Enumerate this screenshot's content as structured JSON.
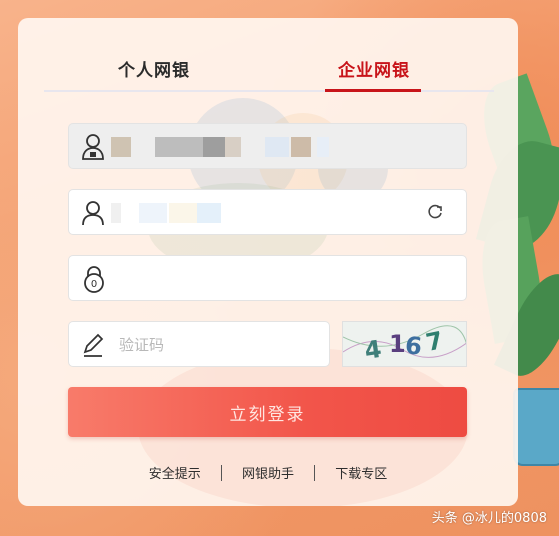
{
  "tabs": {
    "personal": "个人网银",
    "enterprise": "企业网银",
    "active": "enterprise"
  },
  "form": {
    "username_field": {
      "icon": "user-lock-icon",
      "value_masked": true
    },
    "operator_field": {
      "icon": "user-icon",
      "value_masked": true,
      "refresh_icon": "refresh-icon"
    },
    "password_field": {
      "icon": "padlock-icon",
      "value": ""
    },
    "captcha_field": {
      "icon": "pencil-icon",
      "placeholder": "验证码",
      "value": ""
    },
    "captcha_image_text": "4167"
  },
  "login_button": "立刻登录",
  "footer_links": [
    "安全提示",
    "网银助手",
    "下载专区"
  ],
  "watermark": "头条 @冰儿的0808",
  "colors": {
    "accent": "#c8141a",
    "button_start": "#f87b6a",
    "button_end": "#ee4b42",
    "background": "#f6a06f"
  }
}
